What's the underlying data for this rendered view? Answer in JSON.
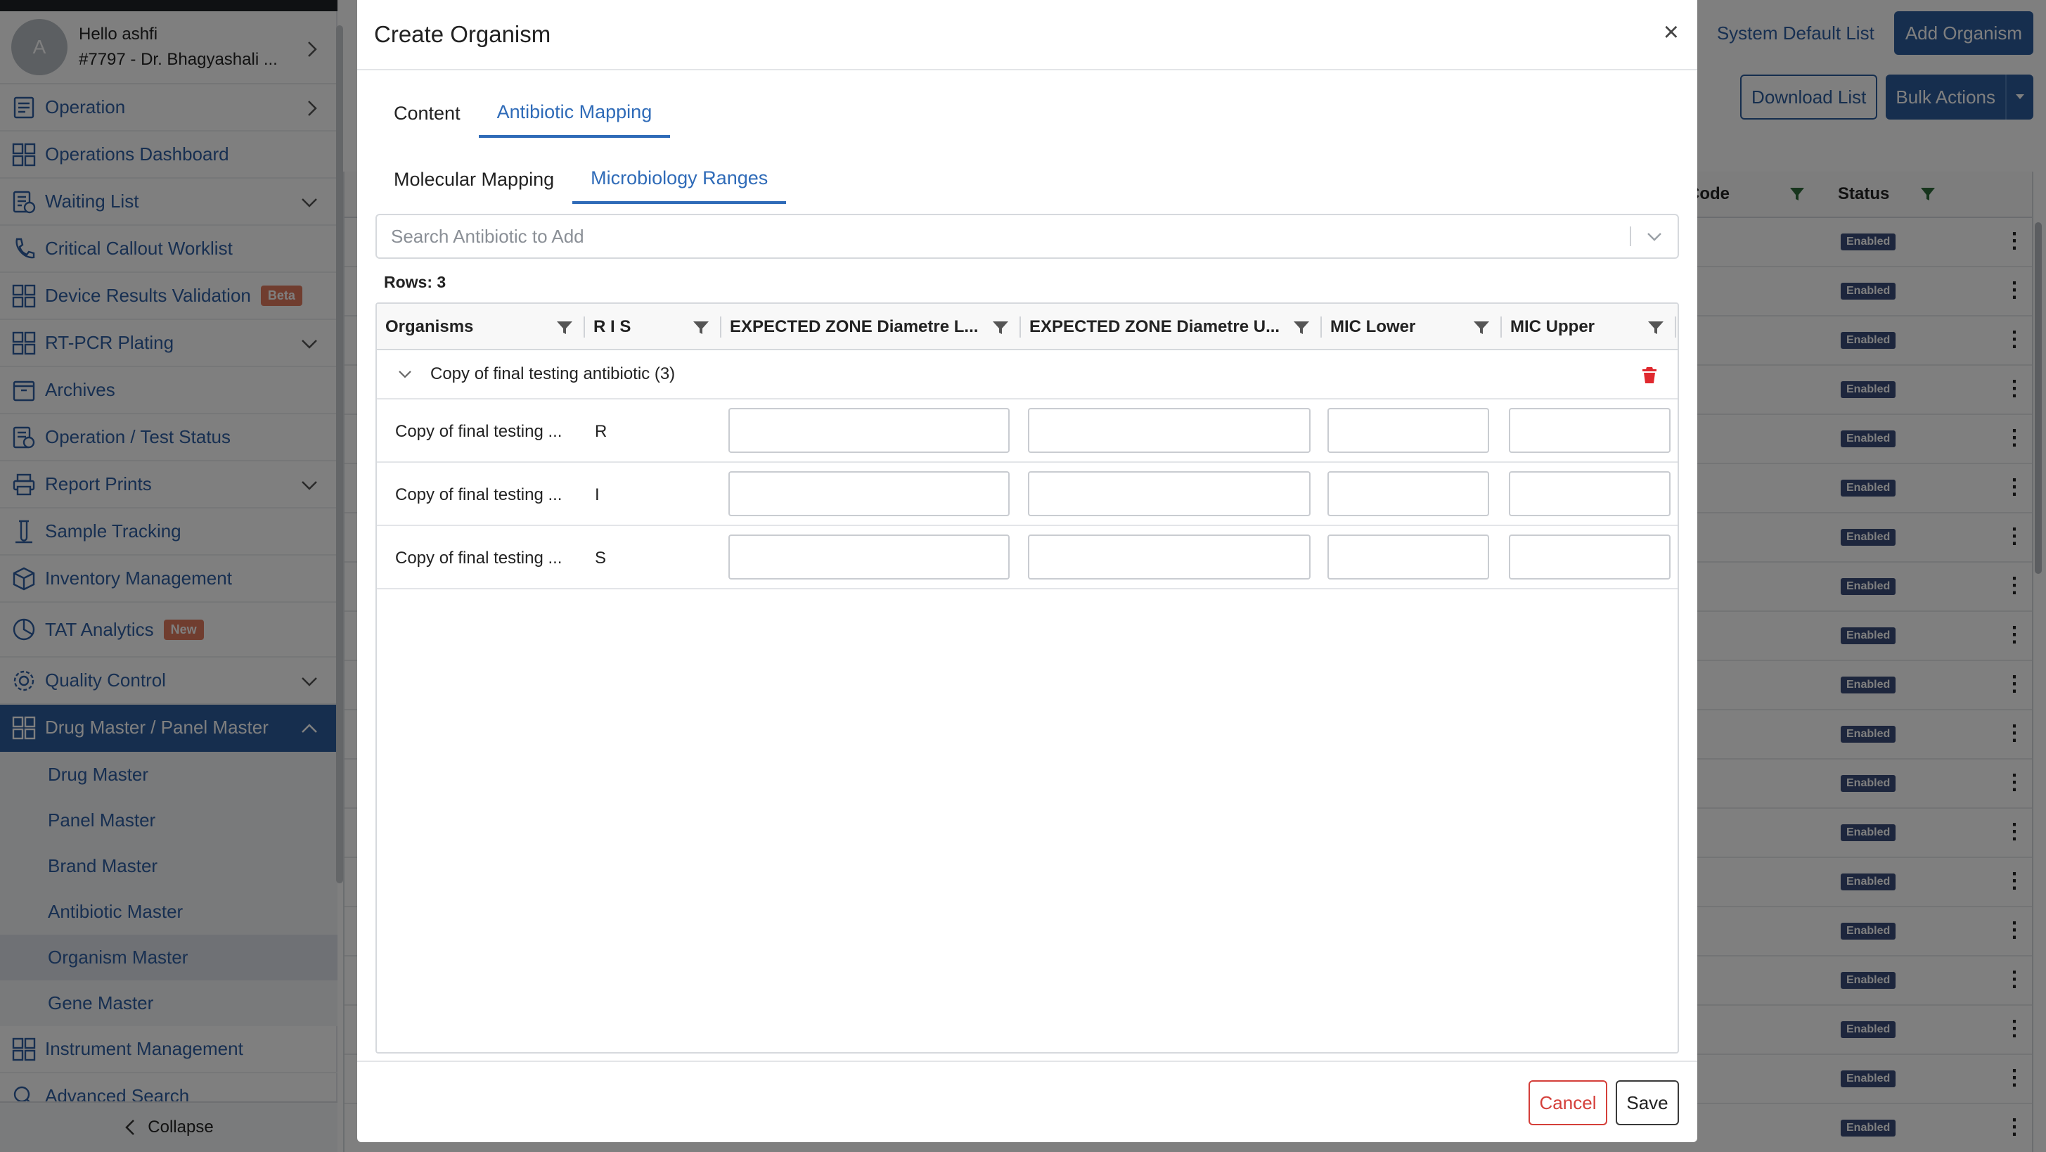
{
  "sidebar": {
    "user": {
      "avatar_letter": "A",
      "greeting": "Hello ashfi",
      "account": "#7797 - Dr. Bhagyashali ..."
    },
    "items": [
      {
        "label": "Operation",
        "icon": "clipboard-icon",
        "chevron": "right"
      },
      {
        "label": "Operations Dashboard",
        "icon": "dashboard-grid-icon",
        "chevron": ""
      },
      {
        "label": "Waiting List",
        "icon": "list-clock-icon",
        "chevron": "down"
      },
      {
        "label": "Critical Callout Worklist",
        "icon": "phone-icon",
        "chevron": ""
      },
      {
        "label": "Device Results Validation",
        "icon": "dashboard-grid-icon",
        "chevron": "",
        "badge": "Beta"
      },
      {
        "label": "RT-PCR Plating",
        "icon": "dashboard-grid-icon",
        "chevron": "down"
      },
      {
        "label": "Archives",
        "icon": "archive-icon",
        "chevron": ""
      },
      {
        "label": "Operation / Test Status",
        "icon": "status-doc-icon",
        "chevron": ""
      },
      {
        "label": "Report Prints",
        "icon": "printer-icon",
        "chevron": "down"
      },
      {
        "label": "Sample Tracking",
        "icon": "test-tube-icon",
        "chevron": ""
      },
      {
        "label": "Inventory Management",
        "icon": "box-icon",
        "chevron": ""
      },
      {
        "label": "TAT Analytics",
        "icon": "pie-chart-icon",
        "chevron": "",
        "badge": "New"
      },
      {
        "label": "Quality Control",
        "icon": "gear-badge-icon",
        "chevron": "down"
      },
      {
        "label": "Drug Master / Panel Master",
        "icon": "dashboard-grid-icon",
        "chevron": "up",
        "active": true
      }
    ],
    "sub_items": [
      "Drug Master",
      "Panel Master",
      "Brand Master",
      "Antibiotic Master",
      "Organism Master",
      "Gene Master"
    ],
    "selected_sub_item": "Organism Master",
    "after_items": [
      {
        "label": "Instrument Management",
        "icon": "dashboard-grid-icon"
      },
      {
        "label": "Advanced Search",
        "icon": "search-icon"
      }
    ],
    "collapse_label": "Collapse"
  },
  "background_page": {
    "system_default_link": "System Default List",
    "add_button": "Add Organism",
    "download_button": "Download List",
    "bulk_actions_button": "Bulk Actions",
    "columns": {
      "code": "Code",
      "status": "Status"
    },
    "row_status": "Enabled",
    "row_count_visible": 19
  },
  "modal": {
    "title": "Create Organism",
    "close_symbol": "×",
    "tabs": [
      {
        "label": "Content",
        "active": false
      },
      {
        "label": "Antibiotic Mapping",
        "active": true
      }
    ],
    "subtabs": [
      {
        "label": "Molecular Mapping",
        "active": false
      },
      {
        "label": "Microbiology Ranges",
        "active": true
      }
    ],
    "search_placeholder": "Search Antibiotic to Add",
    "rows_label": "Rows: 3",
    "grid": {
      "columns": [
        "Organisms",
        "R I S",
        "EXPECTED ZONE Diametre L...",
        "EXPECTED ZONE Diametre U...",
        "MIC Lower",
        "MIC Upper"
      ],
      "group_title": "Copy of final testing antibiotic (3)",
      "rows": [
        {
          "organism": "Copy of final testing ...",
          "ris": "R",
          "zone_lower": "",
          "zone_upper": "",
          "mic_lower": "",
          "mic_upper": ""
        },
        {
          "organism": "Copy of final testing ...",
          "ris": "I",
          "zone_lower": "",
          "zone_upper": "",
          "mic_lower": "",
          "mic_upper": ""
        },
        {
          "organism": "Copy of final testing ...",
          "ris": "S",
          "zone_lower": "",
          "zone_upper": "",
          "mic_lower": "",
          "mic_upper": ""
        }
      ]
    },
    "cancel_label": "Cancel",
    "save_label": "Save"
  },
  "colors": {
    "brand_blue": "#2d5d9c",
    "link_blue": "#2f6bb8",
    "danger_red": "#d43f3a",
    "badge_orange": "#e07b5f",
    "status_pill": "#3a4c7a"
  }
}
